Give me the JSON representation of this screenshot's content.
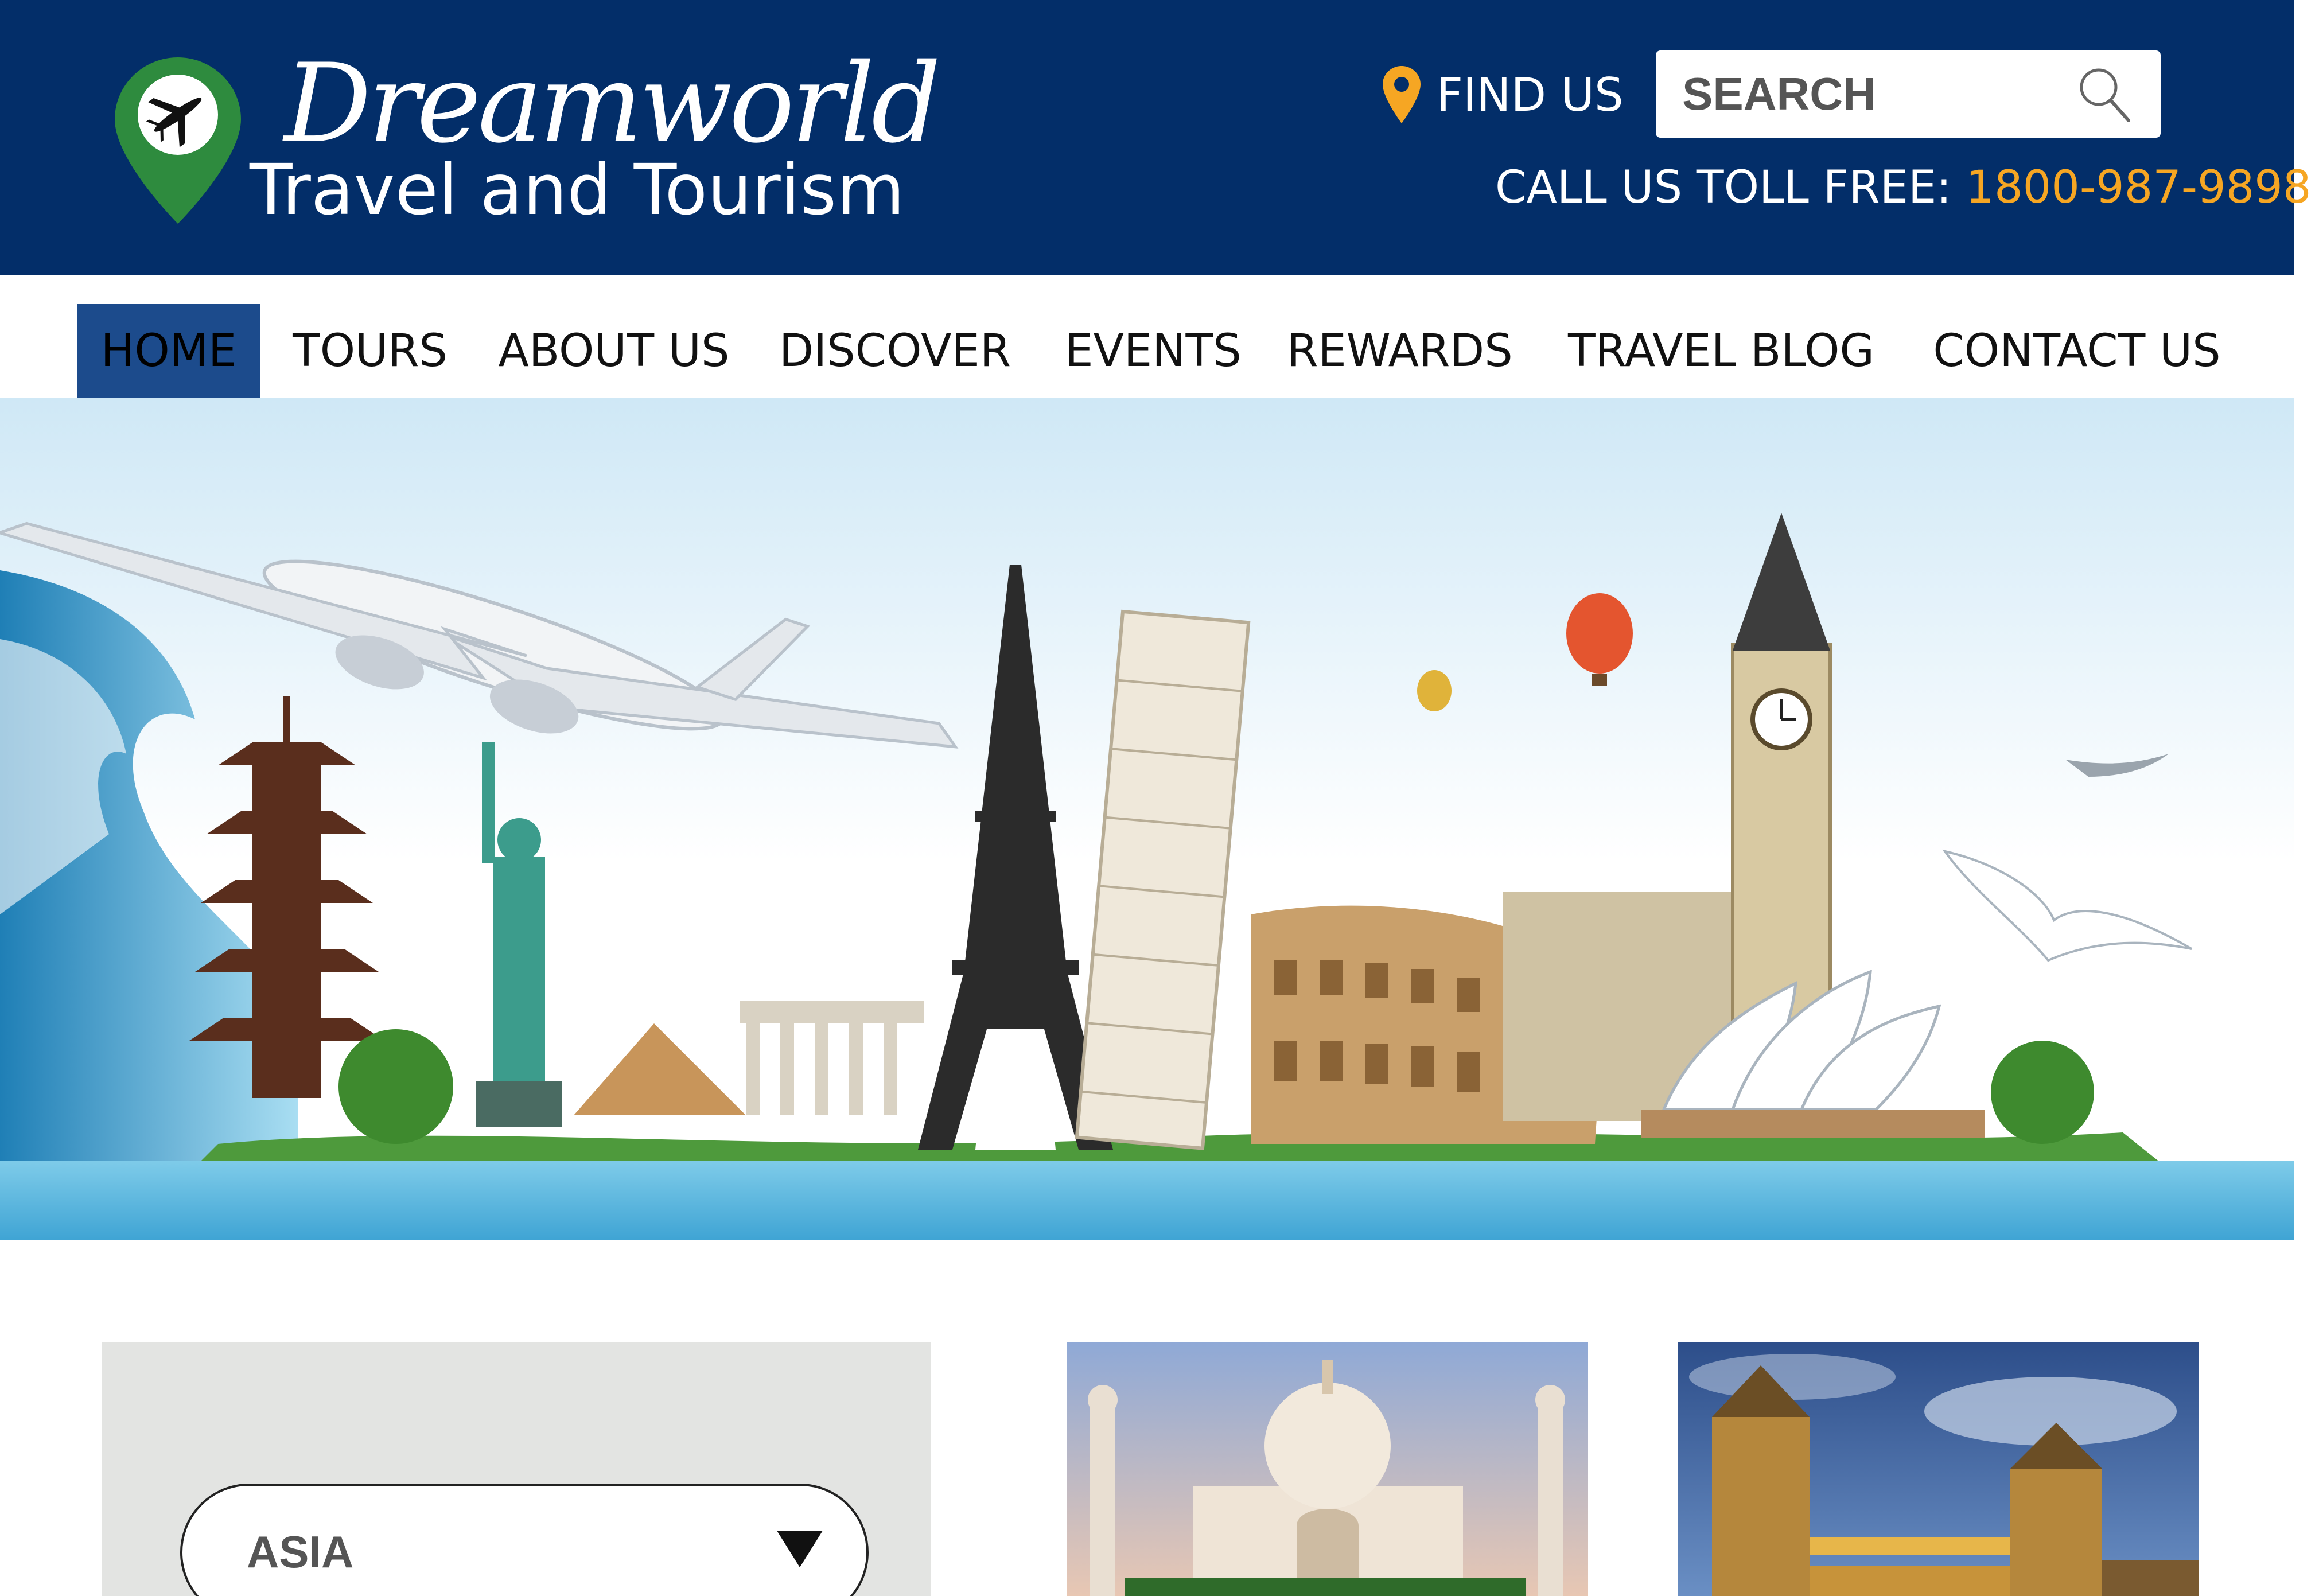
{
  "header": {
    "brand_name": "Dreamworld",
    "brand_tagline": "Travel and Tourism",
    "find_us_label": "FIND US",
    "search_placeholder": "SEARCH",
    "toll_free_label": "CALL US TOLL FREE:",
    "toll_free_number": "1800-987-9898"
  },
  "nav": {
    "items": [
      {
        "label": "HOME",
        "active": true
      },
      {
        "label": "TOURS",
        "active": false
      },
      {
        "label": "ABOUT US",
        "active": false
      },
      {
        "label": "DISCOVER",
        "active": false
      },
      {
        "label": "EVENTS",
        "active": false
      },
      {
        "label": "REWARDS",
        "active": false
      },
      {
        "label": "TRAVEL BLOG",
        "active": false
      },
      {
        "label": "CONTACT US",
        "active": false
      }
    ]
  },
  "filter": {
    "region_selected": "ASIA"
  },
  "icons": {
    "logo": "map-pin-airplane-icon",
    "find_us": "location-pin-icon",
    "search": "magnifier-icon",
    "dropdown": "triangle-down-icon"
  },
  "colors": {
    "header_bg": "#032e69",
    "accent_orange": "#f6a623",
    "nav_active_bg": "#1c4b8c",
    "pin_green": "#2e8b3e",
    "panel_gray": "#e3e4e2"
  }
}
